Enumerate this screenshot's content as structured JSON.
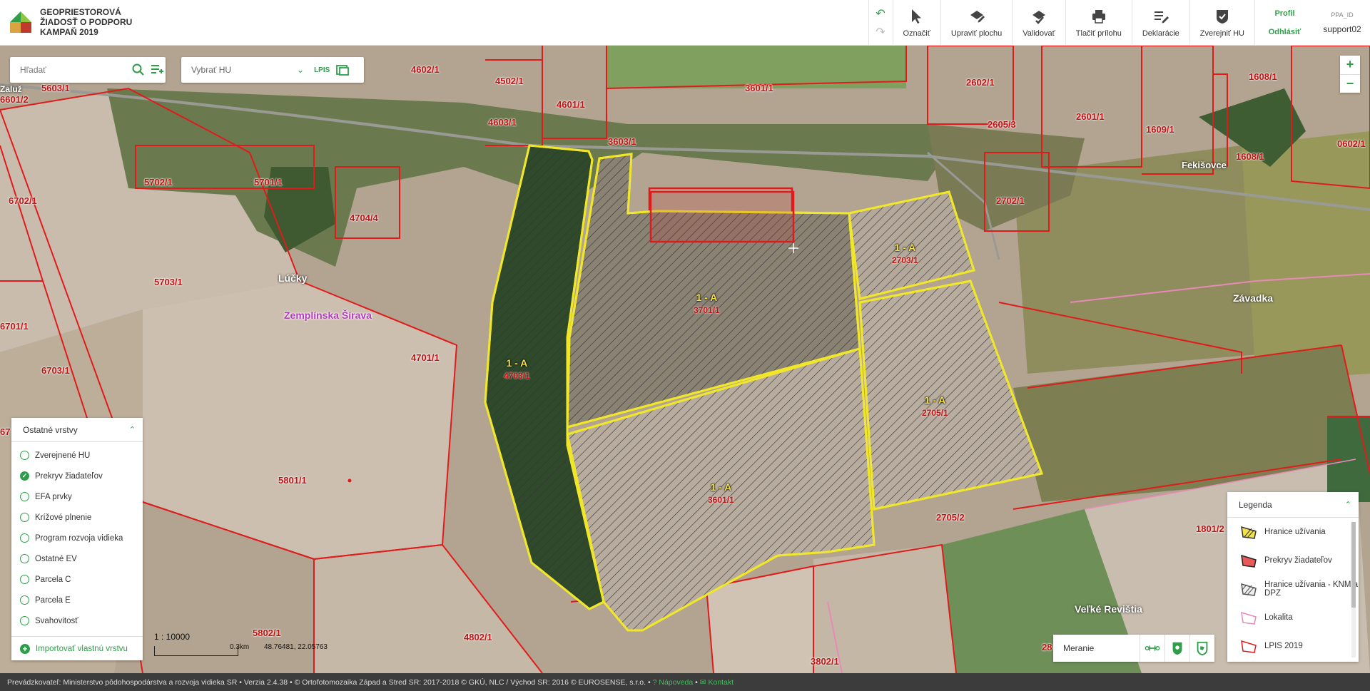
{
  "app": {
    "title_line1": "GEOPRIESTOROVÁ",
    "title_line2": "ŽIADOSŤ O PODPORU",
    "title_line3": "KAMPAŇ 2019"
  },
  "toolbar": {
    "items": [
      {
        "label": "Označiť",
        "icon": "cursor-icon"
      },
      {
        "label": "Upraviť plochu",
        "icon": "edit-area-icon"
      },
      {
        "label": "Validovať",
        "icon": "validate-icon"
      },
      {
        "label": "Tlačiť prílohu",
        "icon": "print-icon"
      },
      {
        "label": "Deklarácie",
        "icon": "declarations-icon"
      },
      {
        "label": "Zverejniť HU",
        "icon": "publish-icon"
      }
    ],
    "profile_label": "Profil",
    "logout_label": "Odhlásiť",
    "ppa_label": "PPA_ID",
    "username": "support02"
  },
  "search": {
    "placeholder": "Hľadať"
  },
  "hu_select": {
    "placeholder": "Vybrať HU",
    "lpis_label": "LPIS"
  },
  "zoom": {
    "in": "+",
    "out": "−"
  },
  "layers": {
    "title": "Ostatné vrstvy",
    "items": [
      {
        "label": "Zverejnené HU",
        "checked": false
      },
      {
        "label": "Prekryv žiadateľov",
        "checked": true
      },
      {
        "label": "EFA prvky",
        "checked": false
      },
      {
        "label": "Krížové plnenie",
        "checked": false
      },
      {
        "label": "Program rozvoja vidieka",
        "checked": false
      },
      {
        "label": "Ostatné EV",
        "checked": false
      },
      {
        "label": "Parcela C",
        "checked": false
      },
      {
        "label": "Parcela E",
        "checked": false
      },
      {
        "label": "Svahovitosť",
        "checked": false
      }
    ],
    "import_label": "Importovať vlastnú vrstvu"
  },
  "scale": {
    "ratio": "1 : 10000",
    "bar_label": "0.3km",
    "coordinates": "48.76481, 22.05763"
  },
  "measure": {
    "label": "Meranie"
  },
  "legend": {
    "title": "Legenda",
    "items": [
      {
        "label": "Hranice užívania"
      },
      {
        "label": "Prekryv žiadateľov"
      },
      {
        "label": "Hranice užívania - KNM a DPZ"
      },
      {
        "label": "Lokalita"
      },
      {
        "label": "LPIS 2019"
      }
    ]
  },
  "map": {
    "parcels": [
      "5603/1",
      "6601/2",
      "4602/1",
      "4502/1",
      "4601/1",
      "4603/1",
      "3601/1",
      "3603/1",
      "2602/1",
      "2605/3",
      "2601/1",
      "1608/1",
      "1609/1",
      "1608/1",
      "0602/1",
      "5702/1",
      "5701/1",
      "4704/4",
      "6702/1",
      "2702/1",
      "5703/1",
      "6701/1",
      "6703/1",
      "4701/1",
      "5801/1",
      "2705/2",
      "1801/2",
      "5802/1",
      "4802/1",
      "3802/1",
      "67",
      "28"
    ],
    "hu_blocks": [
      {
        "code": "1 - A",
        "parcel": "4703/1"
      },
      {
        "code": "1 - A",
        "parcel": "3701/1"
      },
      {
        "code": "1 - A",
        "parcel": "2703/1"
      },
      {
        "code": "1 - A",
        "parcel": "2705/1"
      },
      {
        "code": "1 - A",
        "parcel": "3601/1"
      }
    ],
    "places": [
      "Lúčky",
      "Zemplínska Šírava",
      "Závadka",
      "Fekišovce",
      "Veľké Revištia",
      "Zaluž"
    ]
  },
  "footer": {
    "operator": "Prevádzkovateľ: Ministerstvo pôdohospodárstva a rozvoja vidieka SR",
    "version": "Verzia 2.4.38",
    "copyright": "© Ortofotomozaika Západ a Stred SR: 2017-2018 © GKÚ, NLC / Východ SR: 2016 © EUROSENSE, s.r.o.",
    "help": "Nápoveda",
    "contact": "Kontakt"
  },
  "colors": {
    "accent": "#2e9e49",
    "parcel_line": "#e01b1b",
    "hu_line": "#f0e62a",
    "footer_bg": "#3c3c3c"
  }
}
